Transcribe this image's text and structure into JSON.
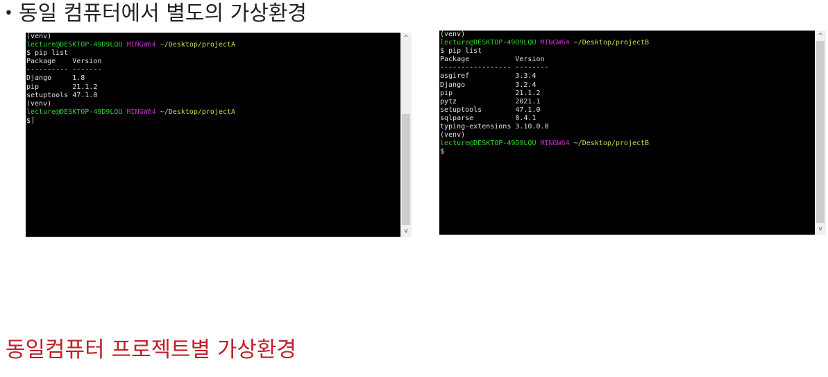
{
  "slide": {
    "bullet": "•",
    "title": "동일 컴퓨터에서 별도의 가상환경",
    "footer_title": "동일컴퓨터 프로젝트별 가상환경"
  },
  "terminal_a": {
    "lines": [
      {
        "parts": [
          {
            "t": "(venv)",
            "c": "white"
          }
        ]
      },
      {
        "parts": [
          {
            "t": "lecture@DESKTOP-49D9LQU ",
            "c": "user"
          },
          {
            "t": "MINGW64 ",
            "c": "mingw"
          },
          {
            "t": "~/Desktop/projectA",
            "c": "path"
          }
        ]
      },
      {
        "parts": [
          {
            "t": "$ pip list",
            "c": "white"
          }
        ]
      },
      {
        "parts": [
          {
            "t": "Package    Version",
            "c": "white"
          }
        ]
      },
      {
        "parts": [
          {
            "t": "---------- -------",
            "c": "white"
          }
        ]
      },
      {
        "parts": [
          {
            "t": "Django     1.8",
            "c": "white"
          }
        ]
      },
      {
        "parts": [
          {
            "t": "pip        21.1.2",
            "c": "white"
          }
        ]
      },
      {
        "parts": [
          {
            "t": "setuptools 47.1.0",
            "c": "white"
          }
        ]
      },
      {
        "parts": [
          {
            "t": "(venv)",
            "c": "white"
          }
        ]
      },
      {
        "parts": [
          {
            "t": "lecture@DESKTOP-49D9LQU ",
            "c": "user"
          },
          {
            "t": "MINGW64 ",
            "c": "mingw"
          },
          {
            "t": "~/Desktop/projectA",
            "c": "path"
          }
        ]
      },
      {
        "parts": [
          {
            "t": "$",
            "c": "white"
          }
        ],
        "caret": true
      }
    ]
  },
  "terminal_b": {
    "lines": [
      {
        "parts": [
          {
            "t": "(venv)",
            "c": "white"
          }
        ]
      },
      {
        "parts": [
          {
            "t": "lecture@DESKTOP-49D9LQU ",
            "c": "user"
          },
          {
            "t": "MINGW64 ",
            "c": "mingw"
          },
          {
            "t": "~/Desktop/projectB",
            "c": "path"
          }
        ]
      },
      {
        "parts": [
          {
            "t": "$ pip list",
            "c": "white"
          }
        ]
      },
      {
        "parts": [
          {
            "t": "Package           Version",
            "c": "white"
          }
        ]
      },
      {
        "parts": [
          {
            "t": "----------------- --------",
            "c": "white"
          }
        ]
      },
      {
        "parts": [
          {
            "t": "asgiref           3.3.4",
            "c": "white"
          }
        ]
      },
      {
        "parts": [
          {
            "t": "Django            3.2.4",
            "c": "white"
          }
        ]
      },
      {
        "parts": [
          {
            "t": "pip               21.1.2",
            "c": "white"
          }
        ]
      },
      {
        "parts": [
          {
            "t": "pytz              2021.1",
            "c": "white"
          }
        ]
      },
      {
        "parts": [
          {
            "t": "setuptools        47.1.0",
            "c": "white"
          }
        ]
      },
      {
        "parts": [
          {
            "t": "sqlparse          0.4.1",
            "c": "white"
          }
        ]
      },
      {
        "parts": [
          {
            "t": "typing-extensions 3.10.0.0",
            "c": "white"
          }
        ]
      },
      {
        "parts": [
          {
            "t": "(venv)",
            "c": "white"
          }
        ]
      },
      {
        "parts": [
          {
            "t": "lecture@DESKTOP-49D9LQU ",
            "c": "user"
          },
          {
            "t": "MINGW64 ",
            "c": "mingw"
          },
          {
            "t": "~/Desktop/projectB",
            "c": "path"
          }
        ]
      },
      {
        "parts": [
          {
            "t": "$",
            "c": "white"
          }
        ]
      }
    ]
  },
  "scrollbar": {
    "up_icon": "chevron-up-icon",
    "down_icon": "chevron-down-icon",
    "up_glyph": "^",
    "down_glyph": "v"
  },
  "colors": {
    "user": "#2fd12f",
    "mingw": "#c030c0",
    "path": "#d6d64a",
    "terminal_bg": "#000000",
    "footer_title": "#c0202a"
  }
}
